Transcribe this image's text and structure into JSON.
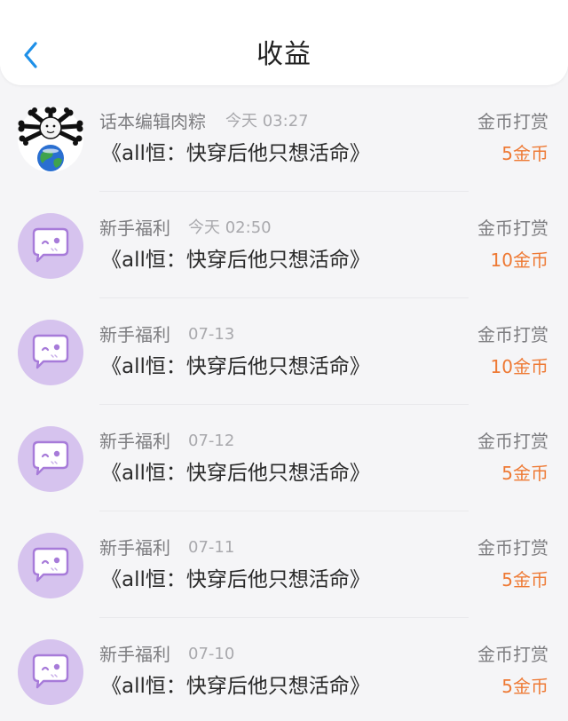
{
  "header": {
    "title": "收益",
    "back_icon": "chevron-left-icon",
    "accent_color": "#1e90e8"
  },
  "colors": {
    "amount": "#ee7a35",
    "bot_avatar_bg": "#d6c3ee",
    "bot_avatar_accent": "#a77bd9"
  },
  "records": [
    {
      "sender": "话本编辑肉粽",
      "time": "今天 03:27",
      "book": "《all恒：快穿后他只想活命》",
      "type": "金币打赏",
      "amount": "5金币",
      "avatar": "user-avatar-icon"
    },
    {
      "sender": "新手福利",
      "time": "今天 02:50",
      "book": "《all恒：快穿后他只想活命》",
      "type": "金币打赏",
      "amount": "10金币",
      "avatar": "chat-bubble-icon"
    },
    {
      "sender": "新手福利",
      "time": "07-13",
      "book": "《all恒：快穿后他只想活命》",
      "type": "金币打赏",
      "amount": "10金币",
      "avatar": "chat-bubble-icon"
    },
    {
      "sender": "新手福利",
      "time": "07-12",
      "book": "《all恒：快穿后他只想活命》",
      "type": "金币打赏",
      "amount": "5金币",
      "avatar": "chat-bubble-icon"
    },
    {
      "sender": "新手福利",
      "time": "07-11",
      "book": "《all恒：快穿后他只想活命》",
      "type": "金币打赏",
      "amount": "5金币",
      "avatar": "chat-bubble-icon"
    },
    {
      "sender": "新手福利",
      "time": "07-10",
      "book": "《all恒：快穿后他只想活命》",
      "type": "金币打赏",
      "amount": "5金币",
      "avatar": "chat-bubble-icon"
    }
  ]
}
